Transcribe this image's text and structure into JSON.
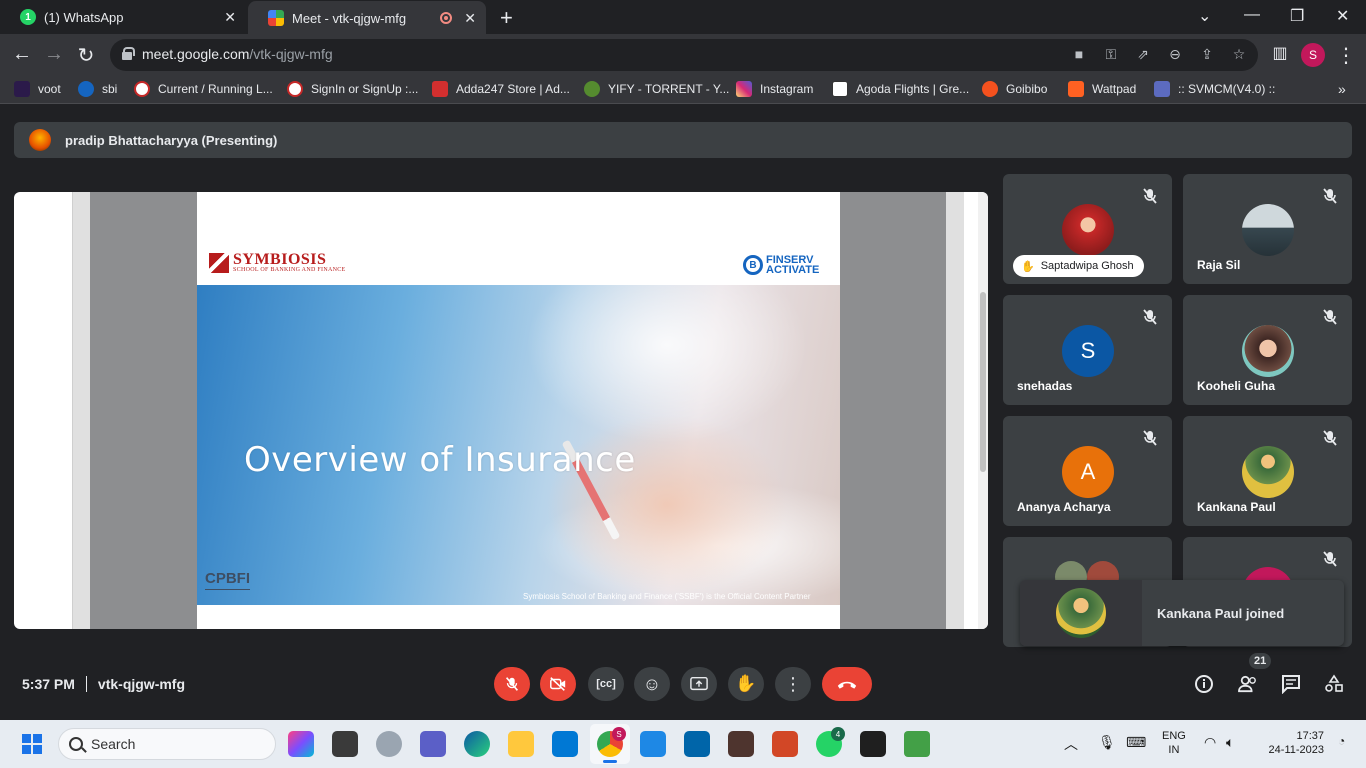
{
  "browser": {
    "tabs": [
      {
        "title": "(1) WhatsApp",
        "active": false
      },
      {
        "title": "Meet - vtk-qjgw-mfg",
        "active": true
      }
    ],
    "url_host": "meet.google.com",
    "url_path": "/vtk-qjgw-mfg",
    "profile_initial": "S",
    "bookmarks": [
      "voot",
      "sbi",
      "Current / Running L...",
      "SignIn or SignUp :...",
      "Adda247 Store | Ad...",
      "YIFY - TORRENT - Y...",
      "Instagram",
      "Agoda Flights | Gre...",
      "Goibibo",
      "Wattpad",
      ":: SVMCM(V4.0) ::"
    ],
    "bookmark_overflow": "»"
  },
  "meet": {
    "presenter": "pradip Bhattacharyya (Presenting)",
    "slide": {
      "brand_left_line1": "SYMBIOSIS",
      "brand_left_line2": "SCHOOL OF BANKING AND FINANCE",
      "brand_right_line1": "FINSERV",
      "brand_right_line2": "ACTIVATE",
      "title": "Overview of Insurance",
      "corner_label": "CPBFI",
      "partner_note": "Symbiosis School of Banking and Finance ('SSBF') is the Official Content Partner"
    },
    "participants": [
      {
        "name": "Saptadwipa Ghosh",
        "initial": "",
        "hand_raised": true,
        "color": "#b71c1c"
      },
      {
        "name": "Raja Sil",
        "initial": "",
        "color": "#5d6b74"
      },
      {
        "name": "snehadas",
        "initial": "S",
        "color": "#0b57a4"
      },
      {
        "name": "Kooheli Guha",
        "initial": "",
        "color": "#7b5b63"
      },
      {
        "name": "Ananya Acharya",
        "initial": "A",
        "color": "#e8710a"
      },
      {
        "name": "Kankana Paul",
        "initial": "",
        "color": "#6a8f4b"
      }
    ],
    "toast": "Kankana Paul joined",
    "time": "5:37 PM",
    "meeting_code": "vtk-qjgw-mfg",
    "participant_count": "21"
  },
  "taskbar": {
    "search_placeholder": "Search",
    "lang_line1": "ENG",
    "lang_line2": "IN",
    "time": "17:37",
    "date": "24-11-2023",
    "chrome_badge": "S",
    "whatsapp_badge": "4"
  },
  "colors": {
    "meet_bg": "#202124",
    "tile_bg": "#3c4043",
    "danger": "#ea4335"
  }
}
